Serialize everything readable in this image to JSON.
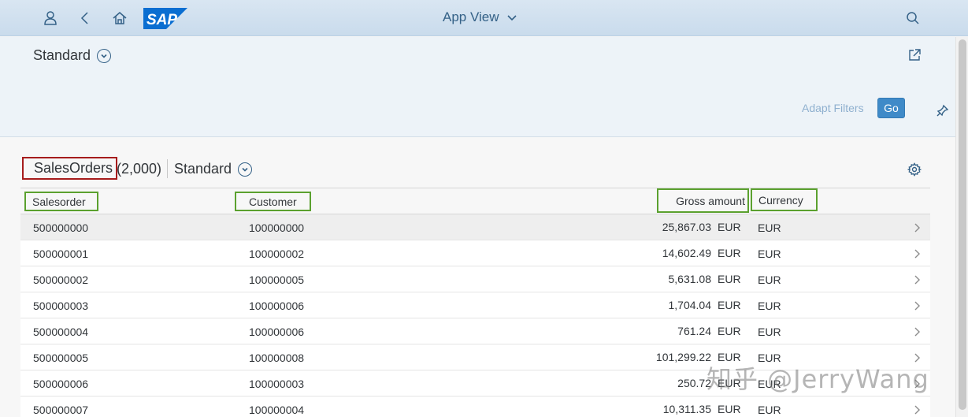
{
  "shell": {
    "app_title": "App View",
    "logo_text": "SAP",
    "brand_color": "#0a6ed1",
    "icons": [
      "user-icon",
      "back-icon",
      "home-icon",
      "search-icon"
    ]
  },
  "filterbar": {
    "variant_label": "Standard",
    "adapt_filters_label": "Adapt Filters",
    "go_label": "Go"
  },
  "table_toolbar": {
    "title": "SalesOrders",
    "count": "(2,000)",
    "variant_label": "Standard"
  },
  "table": {
    "columns": {
      "salesorder": "Salesorder",
      "customer": "Customer",
      "gross_amount": "Gross amount",
      "currency": "Currency"
    },
    "rows": [
      {
        "salesorder": "500000000",
        "customer": "100000000",
        "amount": "25,867.03",
        "unit": "EUR",
        "currency": "EUR"
      },
      {
        "salesorder": "500000001",
        "customer": "100000002",
        "amount": "14,602.49",
        "unit": "EUR",
        "currency": "EUR"
      },
      {
        "salesorder": "500000002",
        "customer": "100000005",
        "amount": "5,631.08",
        "unit": "EUR",
        "currency": "EUR"
      },
      {
        "salesorder": "500000003",
        "customer": "100000006",
        "amount": "1,704.04",
        "unit": "EUR",
        "currency": "EUR"
      },
      {
        "salesorder": "500000004",
        "customer": "100000006",
        "amount": "761.24",
        "unit": "EUR",
        "currency": "EUR"
      },
      {
        "salesorder": "500000005",
        "customer": "100000008",
        "amount": "101,299.22",
        "unit": "EUR",
        "currency": "EUR"
      },
      {
        "salesorder": "500000006",
        "customer": "100000003",
        "amount": "250.72",
        "unit": "EUR",
        "currency": "EUR"
      },
      {
        "salesorder": "500000007",
        "customer": "100000004",
        "amount": "10,311.35",
        "unit": "EUR",
        "currency": "EUR"
      }
    ]
  },
  "watermark": "知乎 @JerryWang",
  "colors": {
    "header_bg": "#d9e6f2",
    "accent": "#346187",
    "go_button": "#3f8ac8",
    "title_highlight": "#a61c1c",
    "column_highlight": "#5ba12f"
  }
}
